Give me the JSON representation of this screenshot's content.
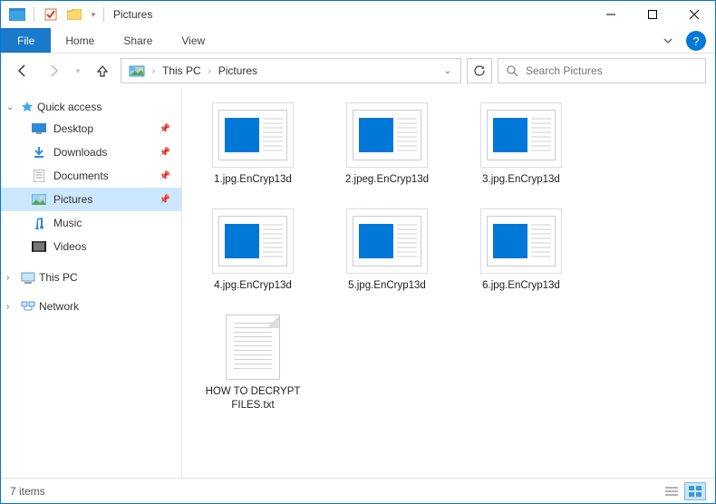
{
  "window": {
    "title": "Pictures"
  },
  "ribbon": {
    "file": "File",
    "home": "Home",
    "share": "Share",
    "view": "View"
  },
  "breadcrumb": {
    "root": "This PC",
    "folder": "Pictures"
  },
  "search": {
    "placeholder": "Search Pictures"
  },
  "sidebar": {
    "quick_access": "Quick access",
    "qa_items": [
      {
        "label": "Desktop"
      },
      {
        "label": "Downloads"
      },
      {
        "label": "Documents"
      },
      {
        "label": "Pictures"
      },
      {
        "label": "Music"
      },
      {
        "label": "Videos"
      }
    ],
    "this_pc": "This PC",
    "network": "Network"
  },
  "files": [
    {
      "name": "1.jpg.EnCryp13d",
      "type": "image"
    },
    {
      "name": "2.jpeg.EnCryp13d",
      "type": "image"
    },
    {
      "name": "3.jpg.EnCryp13d",
      "type": "image"
    },
    {
      "name": "4.jpg.EnCryp13d",
      "type": "image"
    },
    {
      "name": "5.jpg.EnCryp13d",
      "type": "image"
    },
    {
      "name": "6.jpg.EnCryp13d",
      "type": "image"
    },
    {
      "name": "HOW TO DECRYPT FILES.txt",
      "type": "text"
    }
  ],
  "status": {
    "count": "7 items"
  }
}
